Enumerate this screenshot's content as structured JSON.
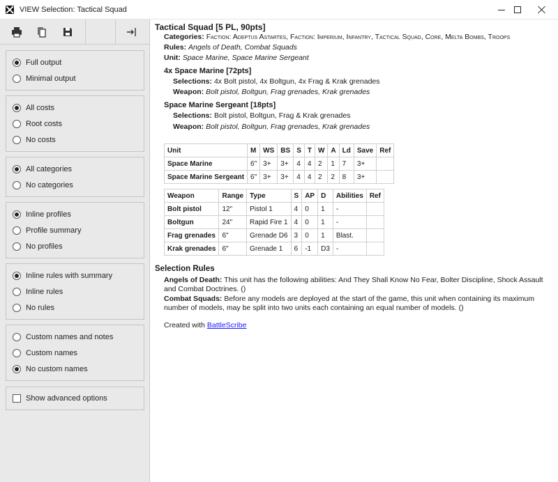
{
  "window": {
    "title": "VIEW Selection: Tactical Squad"
  },
  "toolbar": {
    "icons": [
      "print-icon",
      "copy-icon",
      "save-icon",
      "exit-icon"
    ]
  },
  "options": {
    "output": [
      "Full output",
      "Minimal output"
    ],
    "output_selected": "Full output",
    "costs": [
      "All costs",
      "Root costs",
      "No costs"
    ],
    "costs_selected": "All costs",
    "categories": [
      "All categories",
      "No categories"
    ],
    "categories_selected": "All categories",
    "profiles": [
      "Inline profiles",
      "Profile summary",
      "No profiles"
    ],
    "profiles_selected": "Inline profiles",
    "rules": [
      "Inline rules with summary",
      "Inline rules",
      "No rules"
    ],
    "rules_selected": "Inline rules with summary",
    "names": [
      "Custom names and notes",
      "Custom names",
      "No custom names"
    ],
    "names_selected": "No custom names",
    "advanced": "Show advanced options",
    "advanced_checked": false
  },
  "unit": {
    "heading": "Tactical Squad [5 PL, 90pts]",
    "categories_label": "Categories:",
    "categories_value": "Faction: Adeptus Astartes, Faction: Imperium, Infantry, Tactical Squad, Core, Melta Bombs, Troops",
    "rules_label": "Rules:",
    "rules_value": "Angels of Death, Combat Squads",
    "unit_label": "Unit:",
    "unit_value": "Space Marine, Space Marine Sergeant"
  },
  "sub1": {
    "heading": "4x Space Marine [72pts]",
    "selections_label": "Selections:",
    "selections_value": "4x Bolt pistol, 4x Boltgun, 4x Frag & Krak grenades",
    "weapon_label": "Weapon:",
    "weapon_value": "Bolt pistol, Boltgun, Frag grenades, Krak grenades"
  },
  "sub2": {
    "heading": "Space Marine Sergeant [18pts]",
    "selections_label": "Selections:",
    "selections_value": "Bolt pistol, Boltgun, Frag & Krak grenades",
    "weapon_label": "Weapon:",
    "weapon_value": "Bolt pistol, Boltgun, Frag grenades, Krak grenades"
  },
  "unit_table": {
    "headers": [
      "Unit",
      "M",
      "WS",
      "BS",
      "S",
      "T",
      "W",
      "A",
      "Ld",
      "Save",
      "Ref"
    ],
    "rows": [
      [
        "Space Marine",
        "6\"",
        "3+",
        "3+",
        "4",
        "4",
        "2",
        "1",
        "7",
        "3+",
        ""
      ],
      [
        "Space Marine Sergeant",
        "6\"",
        "3+",
        "3+",
        "4",
        "4",
        "2",
        "2",
        "8",
        "3+",
        ""
      ]
    ]
  },
  "weapon_table": {
    "headers": [
      "Weapon",
      "Range",
      "Type",
      "S",
      "AP",
      "D",
      "Abilities",
      "Ref"
    ],
    "rows": [
      [
        "Bolt pistol",
        "12\"",
        "Pistol 1",
        "4",
        "0",
        "1",
        "-",
        ""
      ],
      [
        "Boltgun",
        "24\"",
        "Rapid Fire 1",
        "4",
        "0",
        "1",
        "-",
        ""
      ],
      [
        "Frag grenades",
        "6\"",
        "Grenade D6",
        "3",
        "0",
        "1",
        "Blast.",
        ""
      ],
      [
        "Krak grenades",
        "6\"",
        "Grenade 1",
        "6",
        "-1",
        "D3",
        "-",
        ""
      ]
    ]
  },
  "selection_rules": {
    "heading": "Selection Rules",
    "r1_label": "Angels of Death:",
    "r1_text": "This unit has the following abilities: And They Shall Know No Fear, Bolter Discipline, Shock Assault and Combat Doctrines. ()",
    "r2_label": "Combat Squads:",
    "r2_text": "Before any models are deployed at the start of the game, this unit when containing its maximum number of models, may be split into two units each containing an equal number of models. ()"
  },
  "footer": {
    "created_with": "Created with",
    "link": "BattleScribe"
  }
}
